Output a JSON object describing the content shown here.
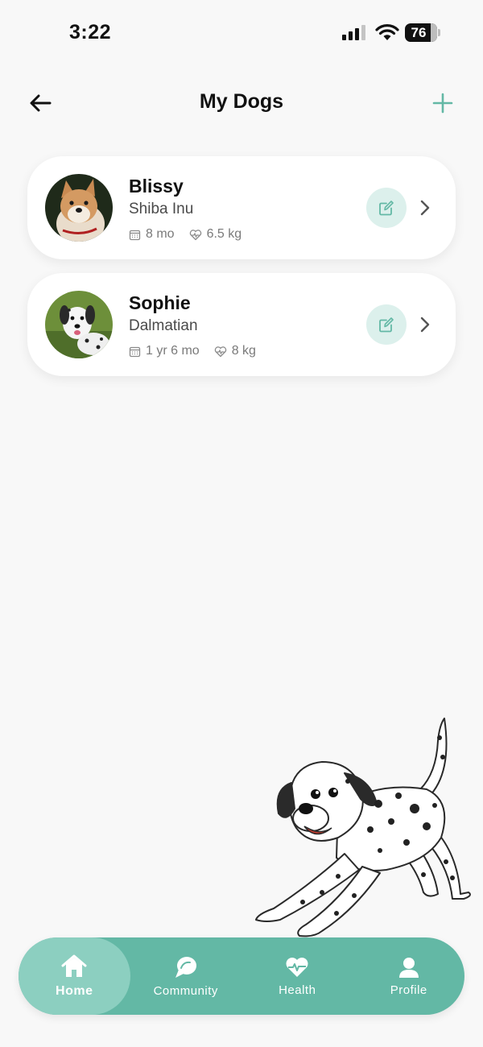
{
  "status_bar": {
    "time": "3:22",
    "battery": "76"
  },
  "header": {
    "title": "My Dogs"
  },
  "dogs": [
    {
      "name": "Blissy",
      "breed": "Shiba Inu",
      "age": "8 mo",
      "weight": "6.5 kg"
    },
    {
      "name": "Sophie",
      "breed": "Dalmatian",
      "age": "1 yr 6 mo",
      "weight": "8 kg"
    }
  ],
  "nav": {
    "items": [
      {
        "label": "Home",
        "icon": "home-icon",
        "active": true
      },
      {
        "label": "Community",
        "icon": "chat-bubble-icon",
        "active": false
      },
      {
        "label": "Health",
        "icon": "heart-pulse-icon",
        "active": false
      },
      {
        "label": "Profile",
        "icon": "person-icon",
        "active": false
      }
    ]
  },
  "colors": {
    "accent": "#63b8a5",
    "accent_light": "#dcf0ec",
    "nav_active": "#8ccfc0"
  }
}
